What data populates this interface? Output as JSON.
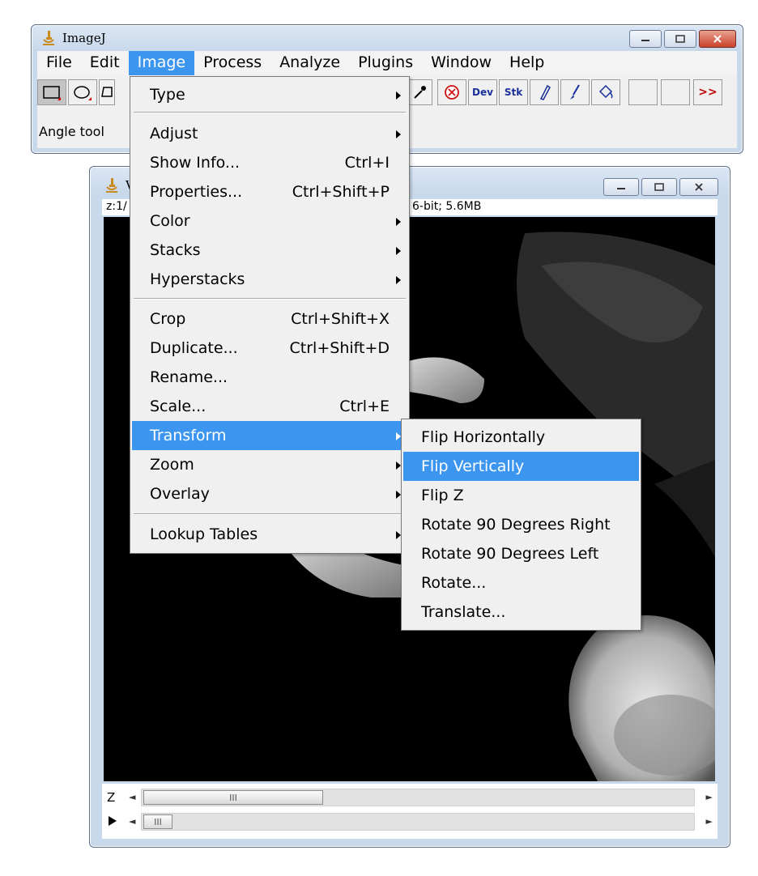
{
  "main_window": {
    "title": "ImageJ",
    "menubar": [
      "File",
      "Edit",
      "Image",
      "Process",
      "Analyze",
      "Plugins",
      "Window",
      "Help"
    ],
    "active_menu": "Image",
    "toolbar": {
      "dev_label": "Dev",
      "stk_label": "Stk",
      "more_label": ">>"
    },
    "status_text": "Angle tool"
  },
  "image_window": {
    "title_fragment": "V",
    "info_left": "z:1/",
    "info_right": "6-bit; 5.6MB",
    "scrollbar_z_label": "Z",
    "scrollbar_thumb_grip": "III"
  },
  "image_menu": {
    "items": [
      {
        "label": "Type",
        "shortcut": "",
        "submenu": true
      },
      {
        "label": "Adjust",
        "shortcut": "",
        "submenu": true
      },
      {
        "label": "Show Info...",
        "shortcut": "Ctrl+I",
        "submenu": false
      },
      {
        "label": "Properties...",
        "shortcut": "Ctrl+Shift+P",
        "submenu": false
      },
      {
        "label": "Color",
        "shortcut": "",
        "submenu": true
      },
      {
        "label": "Stacks",
        "shortcut": "",
        "submenu": true
      },
      {
        "label": "Hyperstacks",
        "shortcut": "",
        "submenu": true
      },
      {
        "label": "Crop",
        "shortcut": "Ctrl+Shift+X",
        "submenu": false
      },
      {
        "label": "Duplicate...",
        "shortcut": "Ctrl+Shift+D",
        "submenu": false
      },
      {
        "label": "Rename...",
        "shortcut": "",
        "submenu": false
      },
      {
        "label": "Scale...",
        "shortcut": "Ctrl+E",
        "submenu": false
      },
      {
        "label": "Transform",
        "shortcut": "",
        "submenu": true
      },
      {
        "label": "Zoom",
        "shortcut": "",
        "submenu": true
      },
      {
        "label": "Overlay",
        "shortcut": "",
        "submenu": true
      },
      {
        "label": "Lookup Tables",
        "shortcut": "",
        "submenu": true
      }
    ]
  },
  "transform_menu": {
    "items": [
      "Flip Horizontally",
      "Flip Vertically",
      "Flip Z",
      "Rotate 90 Degrees Right",
      "Rotate 90 Degrees Left",
      "Rotate...",
      "Translate..."
    ]
  },
  "colors": {
    "highlight": "#3c96f0",
    "menu_bg": "#f0f0f0",
    "close_button": "#c8432c"
  }
}
